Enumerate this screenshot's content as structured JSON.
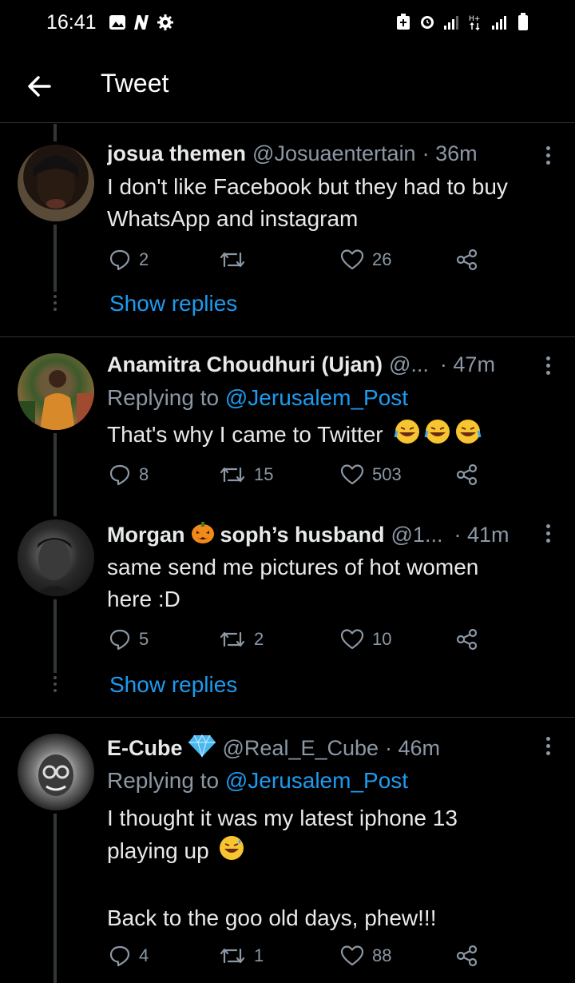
{
  "status_bar": {
    "time": "16:41"
  },
  "header": {
    "title": "Tweet"
  },
  "tweets": [
    {
      "name": "josua themen",
      "handle": "@Josuaentertain",
      "time": "· 36m",
      "text_lines": [
        "I don't like Facebook but they had to buy",
        "WhatsApp and instagram"
      ],
      "replies": "2",
      "retweets": "",
      "likes": "26",
      "show_replies": "Show replies"
    },
    {
      "name": "Anamitra Choudhuri (Ujan)",
      "handle": "@...",
      "time": "· 47m",
      "reply_prefix": "Replying to ",
      "reply_mention": "@Jerusalem_Post",
      "text_lines": [
        "That's why I came to Twitter"
      ],
      "replies": "8",
      "retweets": "15",
      "likes": "503"
    },
    {
      "name_part1": "Morgan",
      "name_part2": "soph’s husband",
      "handle": "@1...",
      "time": "· 41m",
      "text_lines": [
        "same send me pictures of hot women",
        "here :D"
      ],
      "replies": "5",
      "retweets": "2",
      "likes": "10",
      "show_replies": "Show replies"
    },
    {
      "name": "E-Cube",
      "handle": "@Real_E_Cube",
      "time": "· 46m",
      "reply_prefix": "Replying to ",
      "reply_mention": "@Jerusalem_Post",
      "text_lines": [
        "I thought it was my latest iphone 13",
        "playing up",
        "",
        "Back to the goo old days, phew!!!"
      ],
      "replies": "4",
      "retweets": "1",
      "likes": "88"
    }
  ],
  "colors": {
    "accent": "#1d9bf0",
    "secondary_text": "#8b98a5",
    "background": "#000000"
  }
}
